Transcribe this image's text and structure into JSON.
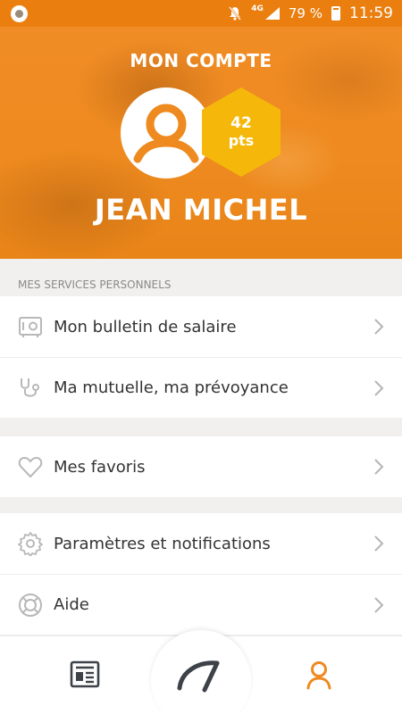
{
  "status_bar": {
    "network": "4G",
    "battery": "79 %",
    "time": "11:59",
    "icons": [
      "app-notification-icon",
      "mute-icon",
      "signal-icon",
      "battery-icon"
    ]
  },
  "header": {
    "title": "MON COMPTE",
    "points_value": "42",
    "points_unit": "pts",
    "user_name": "JEAN MICHEL",
    "accent_color": "#ee8a1f",
    "badge_color": "#f5b80a"
  },
  "personal_services": {
    "section_label": "MES SERVICES PERSONNELS",
    "items": [
      {
        "label": "Mon bulletin de salaire",
        "icon": "safe-icon"
      },
      {
        "label": "Ma mutuelle, ma prévoyance",
        "icon": "stethoscope-icon"
      }
    ]
  },
  "favorites": {
    "items": [
      {
        "label": "Mes favoris",
        "icon": "heart-icon"
      }
    ]
  },
  "settings": {
    "items": [
      {
        "label": "Paramètres et notifications",
        "icon": "gear-icon"
      },
      {
        "label": "Aide",
        "icon": "lifebuoy-icon"
      }
    ]
  },
  "bottom_nav": {
    "items": [
      {
        "icon": "news-icon",
        "active": false
      },
      {
        "icon": "gauge-icon",
        "active": false
      },
      {
        "icon": "profile-icon",
        "active": true
      }
    ]
  }
}
